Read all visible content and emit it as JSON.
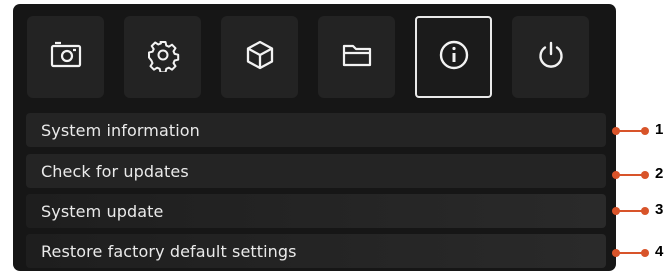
{
  "toolbar": {
    "tabs": [
      {
        "icon": "camera-icon",
        "active": false
      },
      {
        "icon": "gear-icon",
        "active": false
      },
      {
        "icon": "cube-icon",
        "active": false
      },
      {
        "icon": "folder-icon",
        "active": false
      },
      {
        "icon": "info-icon",
        "active": true
      },
      {
        "icon": "power-icon",
        "active": false
      }
    ]
  },
  "menu": {
    "items": [
      {
        "label": "System information"
      },
      {
        "label": "Check for updates"
      },
      {
        "label": "System update"
      },
      {
        "label": "Restore factory default settings"
      }
    ]
  },
  "callouts": {
    "items": [
      {
        "number": "1"
      },
      {
        "number": "2"
      },
      {
        "number": "3"
      },
      {
        "number": "4"
      }
    ]
  },
  "colors": {
    "panel": "#161616",
    "tab": "#232323",
    "menu_item": "#242424",
    "callout": "#d8542a",
    "text": "#eaeaea"
  }
}
